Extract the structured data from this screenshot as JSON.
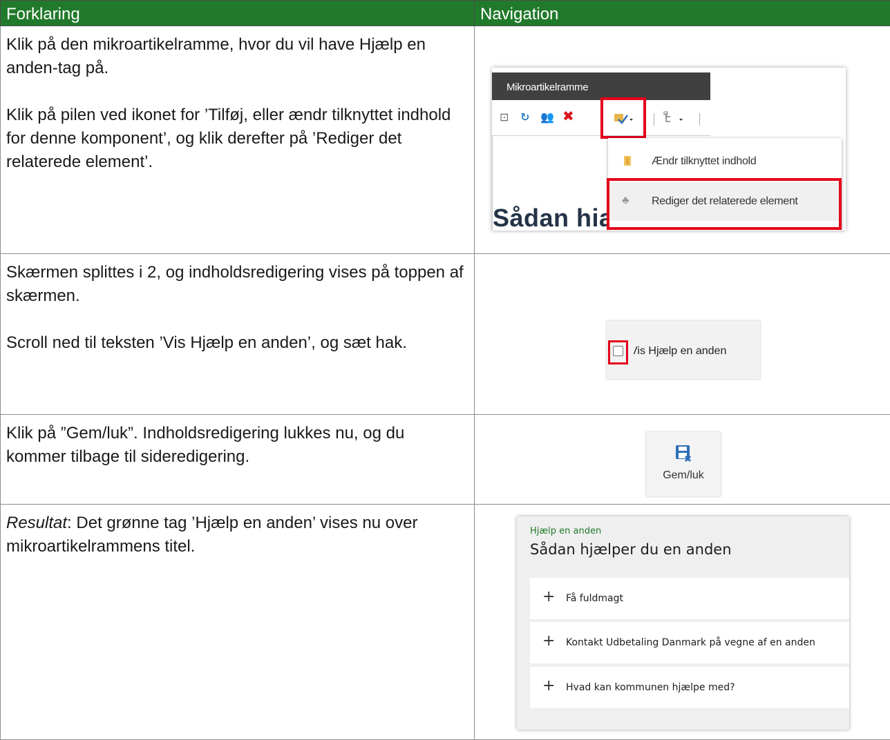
{
  "table": {
    "headers": {
      "left": "Forklaring",
      "right": "Navigation"
    },
    "rows": [
      {
        "paragraphs": [
          "Klik på den mikroartikelramme, hvor du vil have Hjælp en anden-tag på.",
          "Klik på pilen ved ikonet for ’Tilføj, eller ændr tilknyttet indhold for denne komponent’, og klik derefter på ’Rediger det relaterede element’."
        ]
      },
      {
        "paragraphs": [
          "Skærmen splittes i 2, og indholdsredigering vises på toppen af skærmen.",
          "Scroll ned til teksten ’Vis Hjælp en anden’, og sæt hak."
        ]
      },
      {
        "paragraphs": [
          "Klik på ”Gem/luk”. Indholdsredigering lukkes nu, og du kommer tilbage til sideredigering."
        ]
      },
      {
        "result_label": "Resultat",
        "result_text": ": Det grønne tag ’Hjælp en anden’ vises nu over mikroartikelrammens titel."
      }
    ]
  },
  "screenshot_1": {
    "panel_title": "Mikroartikelramme",
    "heading_fragment": "Sådan hia",
    "menu_items": [
      "Ændr tilknyttet indhold",
      "Rediger det relaterede element"
    ],
    "highlight_color": "#e3001b"
  },
  "screenshot_2": {
    "checkbox_label": "Vis Hjælp en anden",
    "checked": false
  },
  "screenshot_3": {
    "button_label": "Gem/luk"
  },
  "screenshot_4": {
    "tag": "Hjælp en anden",
    "title": "Sådan hjælper du en anden",
    "accordion_items": [
      "Få fuldmagt",
      "Kontakt Udbetaling Danmark på vegne af en anden",
      "Hvad kan kommunen hjælpe med?"
    ]
  },
  "colors": {
    "header_green": "#217a2b",
    "tag_green": "#1f7a2a",
    "heading_navy": "#243447"
  }
}
